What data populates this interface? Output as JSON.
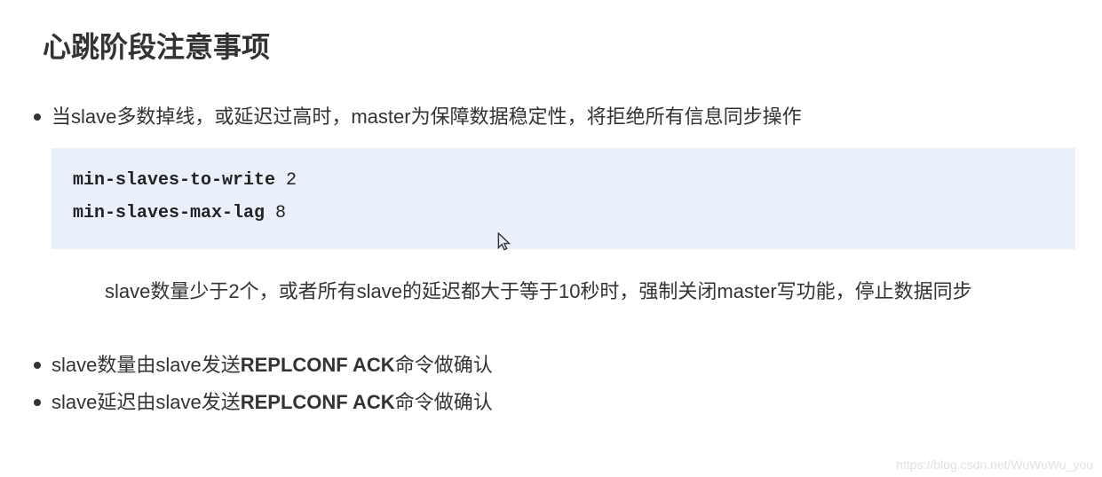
{
  "title": "心跳阶段注意事项",
  "bullets": {
    "item1": "当slave多数掉线，或延迟过高时，master为保障数据稳定性，将拒绝所有信息同步操作",
    "item2_prefix": "slave数量由slave发送",
    "item2_bold": "REPLCONF ACK",
    "item2_suffix": "命令做确认",
    "item3_prefix": "slave延迟由slave发送",
    "item3_bold": "REPLCONF ACK",
    "item3_suffix": "命令做确认"
  },
  "code": {
    "line1_key": "min-slaves-to-write",
    "line1_val": " 2",
    "line2_key": "min-slaves-max-lag",
    "line2_val": " 8"
  },
  "subtext": "slave数量少于2个，或者所有slave的延迟都大于等于10秒时，强制关闭master写功能，停止数据同步",
  "watermark": "https://blog.csdn.net/WuWuWu_you"
}
